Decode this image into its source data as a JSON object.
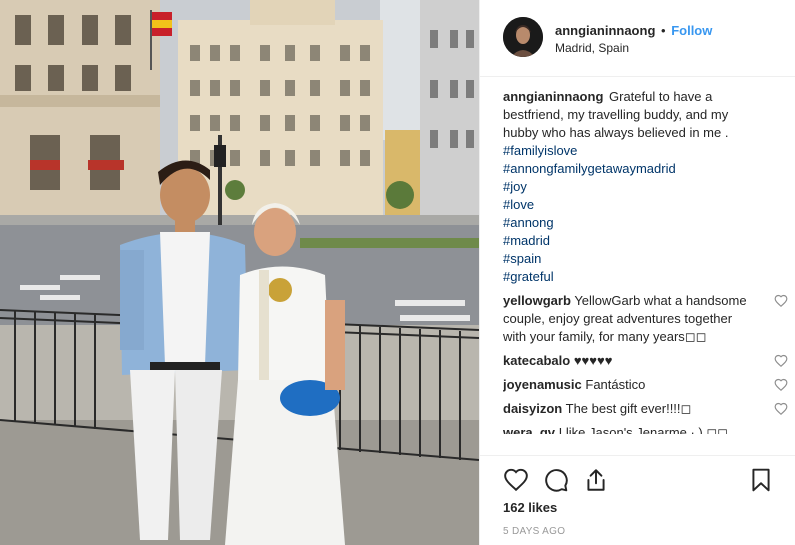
{
  "header": {
    "username": "anngianinnaong",
    "separator": "•",
    "follow_label": "Follow",
    "location": "Madrid, Spain"
  },
  "caption": {
    "username": "anngianinnaong",
    "text_lines": [
      "Grateful to have a",
      "bestfriend, my travelling buddy, and my",
      "hubby who has always believed in me ."
    ],
    "hashtags": [
      "#familyislove",
      "#annongfamilygetawaymadrid",
      "#joy",
      "#love",
      "#annong",
      "#madrid",
      "#spain",
      "#grateful"
    ]
  },
  "comments": [
    {
      "username": "yellowgarb",
      "text": "YellowGarb what a handsome couple, enjoy great adventures together with your family, for many years◻◻"
    },
    {
      "username": "katecabalo",
      "text": "♥♥♥♥♥"
    },
    {
      "username": "joyenamusic",
      "text": "Fantástico"
    },
    {
      "username": "daisyizon",
      "text": "The best gift ever!!!!◻"
    },
    {
      "username": "wera_gv",
      "text": "I like Jason's Jenarme · ) ◻◻"
    }
  ],
  "actions": {
    "icons": [
      "heart-outline-icon",
      "comment-bubble-icon",
      "share-icon",
      "bookmark-icon"
    ],
    "likes": "162 likes",
    "time_ago": "5 DAYS AGO"
  },
  "colors": {
    "link_blue": "#3897f0",
    "hashtag_blue": "#003569",
    "border": "#efefef",
    "muted": "#999999",
    "text": "#262626"
  }
}
